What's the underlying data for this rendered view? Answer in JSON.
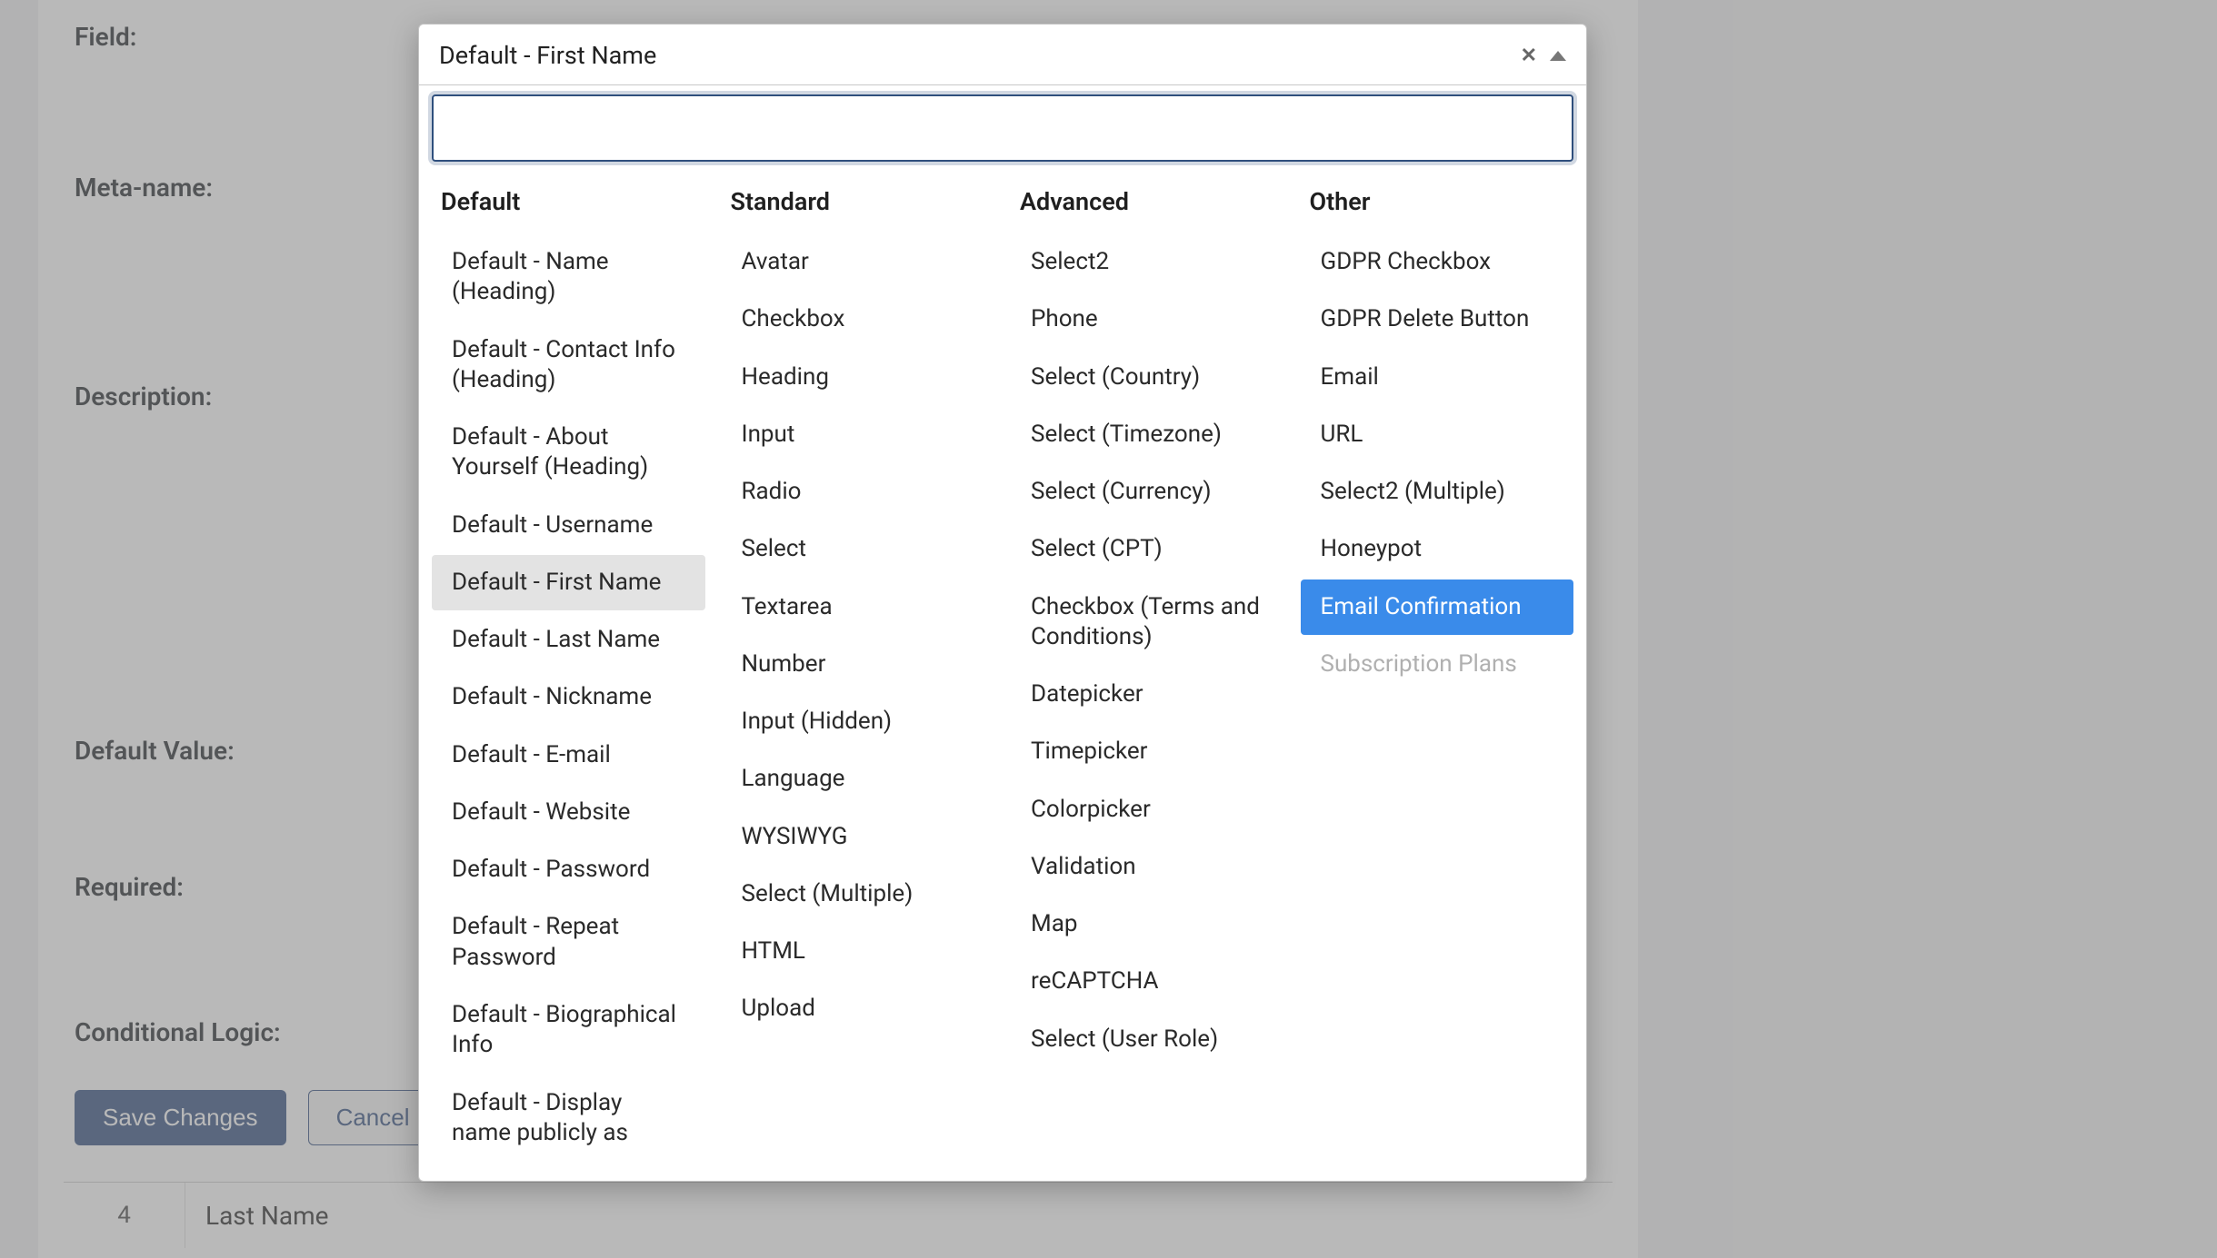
{
  "form": {
    "labels": {
      "field": "Field:",
      "meta_name": "Meta-name:",
      "description": "Description:",
      "default_value": "Default Value:",
      "required": "Required:",
      "conditional_logic": "Conditional Logic:"
    },
    "buttons": {
      "save": "Save Changes",
      "cancel": "Cancel"
    },
    "row_preview": {
      "index": "4",
      "name": "Last Name"
    }
  },
  "dropdown": {
    "current": "Default - First Name",
    "search": "",
    "groups": [
      {
        "title": "Default",
        "options": [
          {
            "label": "Default - Name (Heading)"
          },
          {
            "label": "Default - Contact Info (Heading)"
          },
          {
            "label": "Default - About Yourself (Heading)"
          },
          {
            "label": "Default - Username"
          },
          {
            "label": "Default - First Name",
            "selected": true
          },
          {
            "label": "Default - Last Name"
          },
          {
            "label": "Default - Nickname"
          },
          {
            "label": "Default - E-mail"
          },
          {
            "label": "Default - Website"
          },
          {
            "label": "Default - Password"
          },
          {
            "label": "Default - Repeat Password"
          },
          {
            "label": "Default - Biographical Info"
          },
          {
            "label": "Default - Display name publicly as"
          }
        ]
      },
      {
        "title": "Standard",
        "options": [
          {
            "label": "Avatar"
          },
          {
            "label": "Checkbox"
          },
          {
            "label": "Heading"
          },
          {
            "label": "Input"
          },
          {
            "label": "Radio"
          },
          {
            "label": "Select"
          },
          {
            "label": "Textarea"
          },
          {
            "label": "Number"
          },
          {
            "label": "Input (Hidden)"
          },
          {
            "label": "Language"
          },
          {
            "label": "WYSIWYG"
          },
          {
            "label": "Select (Multiple)"
          },
          {
            "label": "HTML"
          },
          {
            "label": "Upload"
          }
        ]
      },
      {
        "title": "Advanced",
        "options": [
          {
            "label": "Select2"
          },
          {
            "label": "Phone"
          },
          {
            "label": "Select (Country)"
          },
          {
            "label": "Select (Timezone)"
          },
          {
            "label": "Select (Currency)"
          },
          {
            "label": "Select (CPT)"
          },
          {
            "label": "Checkbox (Terms and Conditions)"
          },
          {
            "label": "Datepicker"
          },
          {
            "label": "Timepicker"
          },
          {
            "label": "Colorpicker"
          },
          {
            "label": "Validation"
          },
          {
            "label": "Map"
          },
          {
            "label": "reCAPTCHA"
          },
          {
            "label": "Select (User Role)"
          }
        ]
      },
      {
        "title": "Other",
        "options": [
          {
            "label": "GDPR Checkbox"
          },
          {
            "label": "GDPR Delete Button"
          },
          {
            "label": "Email"
          },
          {
            "label": "URL"
          },
          {
            "label": "Select2 (Multiple)"
          },
          {
            "label": "Honeypot"
          },
          {
            "label": "Email Confirmation",
            "highlight": true
          },
          {
            "label": "Subscription Plans",
            "disabled": true
          }
        ]
      }
    ]
  }
}
